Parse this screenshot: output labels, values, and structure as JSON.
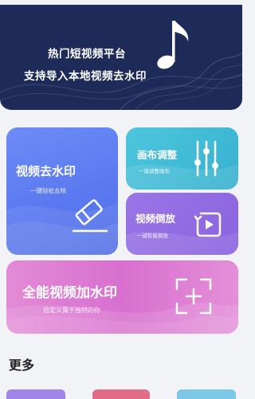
{
  "banner": {
    "line1": "热门短视频平台",
    "line2": "支持导入本地视频去水印",
    "icon": "music-note-icon"
  },
  "cards": {
    "remove_watermark": {
      "title": "视频去水印",
      "subtitle": "一键轻松去除",
      "icon": "eraser-icon"
    },
    "canvas_adjust": {
      "title": "画布调整",
      "subtitle": "一键调整画布",
      "icon": "sliders-icon"
    },
    "video_reverse": {
      "title": "视频倒放",
      "subtitle": "一键智能倒放",
      "icon": "reverse-play-icon"
    },
    "add_watermark": {
      "title": "全能视频加水印",
      "subtitle": "自定义属于独特的你",
      "icon": "add-frame-icon"
    }
  },
  "more": {
    "title": "更多"
  },
  "colors": {
    "banner_bg": "#1e2a58",
    "wm_card": "#5a78ef",
    "canvas_card": "#36b0cf",
    "reverse_card": "#8a62de",
    "add_card": "#d86fcf"
  }
}
